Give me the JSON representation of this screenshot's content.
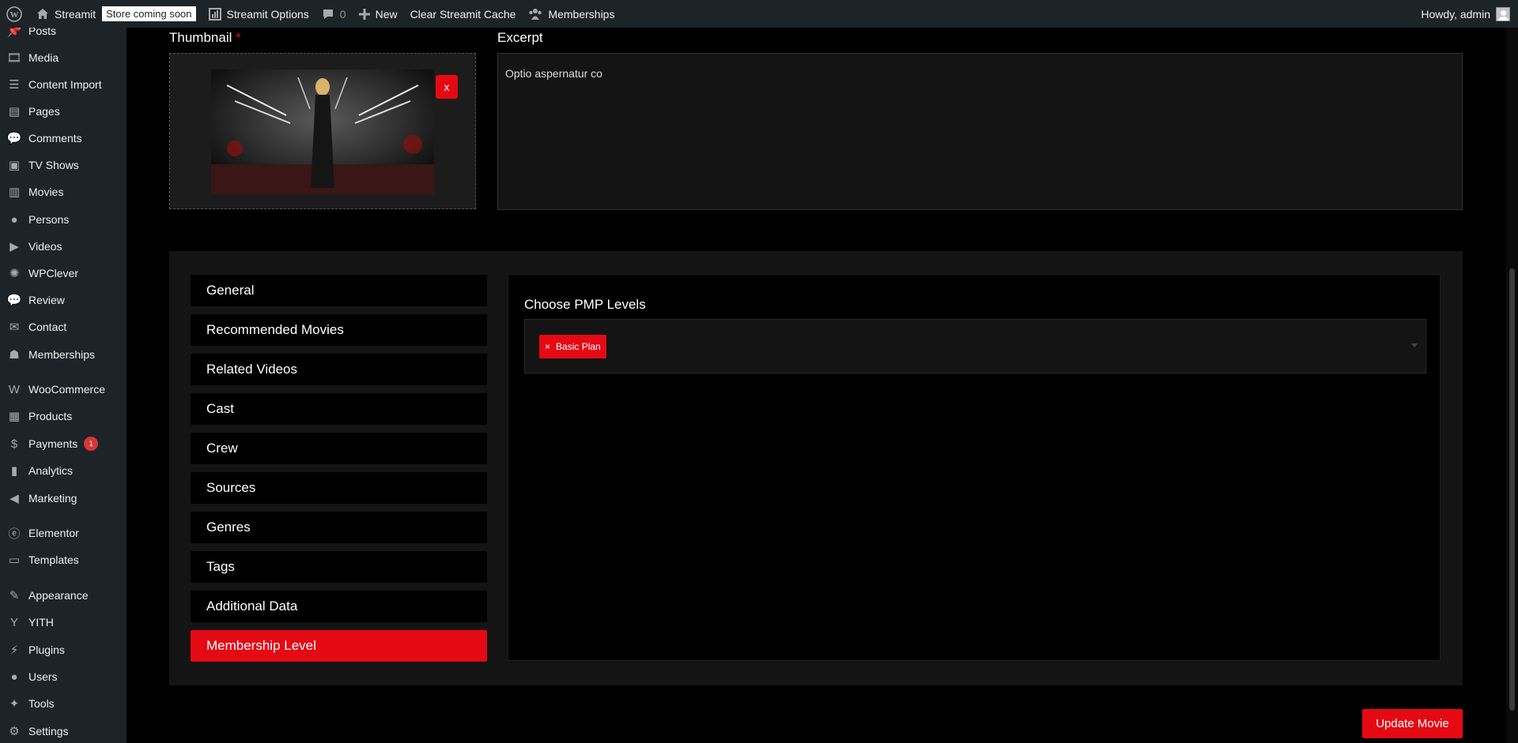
{
  "adminbar": {
    "site_name": "Streamit",
    "store_badge": "Store coming soon",
    "options": "Streamit Options",
    "comments_count": "0",
    "new_label": "New",
    "clear_cache": "Clear Streamit Cache",
    "memberships": "Memberships",
    "howdy": "Howdy, admin"
  },
  "sidebar": {
    "items": [
      {
        "label": "Posts",
        "icon": "pin-icon"
      },
      {
        "label": "Media",
        "icon": "media-icon"
      },
      {
        "label": "Content Import",
        "icon": "database-icon"
      },
      {
        "label": "Pages",
        "icon": "pages-icon"
      },
      {
        "label": "Comments",
        "icon": "comment-icon"
      },
      {
        "label": "TV Shows",
        "icon": "tv-icon"
      },
      {
        "label": "Movies",
        "icon": "film-icon"
      },
      {
        "label": "Persons",
        "icon": "person-icon"
      },
      {
        "label": "Videos",
        "icon": "video-icon"
      },
      {
        "label": "WPClever",
        "icon": "lightbulb-icon"
      },
      {
        "label": "Review",
        "icon": "comment-icon"
      },
      {
        "label": "Contact",
        "icon": "mail-icon"
      },
      {
        "label": "Memberships",
        "icon": "groups-icon"
      },
      {
        "label": "WooCommerce",
        "icon": "woo-icon"
      },
      {
        "label": "Products",
        "icon": "archive-icon"
      },
      {
        "label": "Payments",
        "icon": "dollar-icon",
        "badge": "1"
      },
      {
        "label": "Analytics",
        "icon": "chart-bar-icon"
      },
      {
        "label": "Marketing",
        "icon": "megaphone-icon"
      },
      {
        "label": "Elementor",
        "icon": "elementor-icon"
      },
      {
        "label": "Templates",
        "icon": "folder-icon"
      },
      {
        "label": "Appearance",
        "icon": "brush-icon"
      },
      {
        "label": "YITH",
        "icon": "yith-icon"
      },
      {
        "label": "Plugins",
        "icon": "plug-icon"
      },
      {
        "label": "Users",
        "icon": "person-icon"
      },
      {
        "label": "Tools",
        "icon": "wrench-icon"
      },
      {
        "label": "Settings",
        "icon": "settings-icon"
      }
    ]
  },
  "thumbnail": {
    "label": "Thumbnail",
    "required_mark": "*",
    "remove_label": "x"
  },
  "excerpt": {
    "label": "Excerpt",
    "value": "Optio aspernatur co"
  },
  "tabs": [
    {
      "label": "General"
    },
    {
      "label": "Recommended Movies"
    },
    {
      "label": "Related Videos"
    },
    {
      "label": "Cast"
    },
    {
      "label": "Crew"
    },
    {
      "label": "Sources"
    },
    {
      "label": "Genres"
    },
    {
      "label": "Tags"
    },
    {
      "label": "Additional Data"
    },
    {
      "label": "Membership Level",
      "active": true
    }
  ],
  "pmp": {
    "label": "Choose PMP Levels",
    "selected": [
      {
        "label": "Basic Plan",
        "remove": "×"
      }
    ]
  },
  "update_button": "Update Movie",
  "colors": {
    "accent": "#e50914",
    "adminbar_bg": "#1d2327",
    "panel_bg": "#141414"
  }
}
